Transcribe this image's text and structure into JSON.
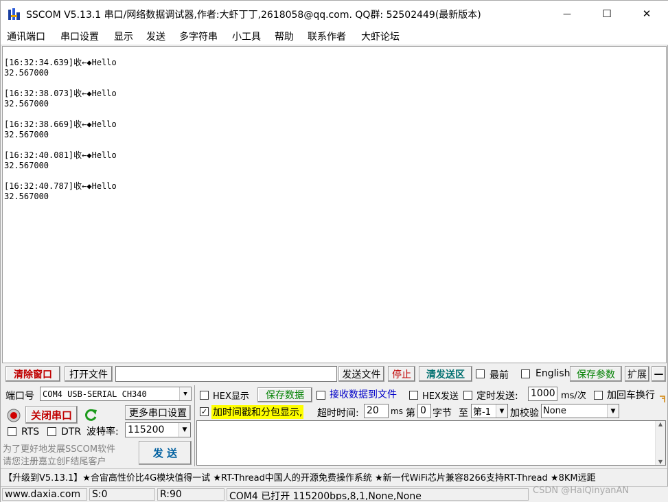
{
  "window": {
    "title": "SSCOM V5.13.1 串口/网络数据调试器,作者:大虾丁丁,2618058@qq.com. QQ群: 52502449(最新版本)",
    "minimize_glyph": "—",
    "maximize_glyph": "☐",
    "close_glyph": "✕",
    "icon": "sscom-app-icon"
  },
  "menu": [
    "通讯端口",
    "串口设置",
    "显示",
    "发送",
    "多字符串",
    "小工具",
    "帮助",
    "联系作者",
    "大虾论坛"
  ],
  "log": [
    {
      "line1": "[16:32:34.639]收←◆Hello",
      "line2": "32.567000"
    },
    {
      "line1": "[16:32:38.073]收←◆Hello",
      "line2": "32.567000"
    },
    {
      "line1": "[16:32:38.669]收←◆Hello",
      "line2": "32.567000"
    },
    {
      "line1": "[16:32:40.081]收←◆Hello",
      "line2": "32.567000"
    },
    {
      "line1": "[16:32:40.787]收←◆Hello",
      "line2": "32.567000"
    }
  ],
  "toolbar": {
    "clear_window": "清除窗口",
    "open_file": "打开文件",
    "file_path": "",
    "send_file": "发送文件",
    "stop": "停止",
    "clear_send_area": "清发送区",
    "topmost": "最前",
    "english": "English",
    "save_params": "保存参数",
    "expand": "扩展",
    "collapse": "—"
  },
  "port": {
    "port_label": "端口号",
    "port_value": "COM4 USB-SERIAL CH340",
    "close_port": "关闭串口",
    "more_settings": "更多串口设置",
    "rts": "RTS",
    "dtr": "DTR",
    "baud_label": "波特率:",
    "baud_value": "115200",
    "promo_line1": "为了更好地发展SSCOM软件",
    "promo_line2": "请您注册嘉立创F结尾客户",
    "send": "发  送"
  },
  "options": {
    "hex_display": "HEX显示",
    "save_data": "保存数据",
    "recv_to_file": "接收数据到文件",
    "hex_send": "HEX发送",
    "timed_send": "定时发送:",
    "interval": "1000",
    "interval_unit": "ms/次",
    "add_crlf": "加回车换行",
    "timestamp": "加时间戳和分包显示,",
    "timeout_label": "超时时间:",
    "timeout_value": "20",
    "timeout_unit": "ms",
    "byte_label_pre": "第",
    "byte_value": "0",
    "byte_label_post": "字节",
    "to_label": "至",
    "to_value": "第-1",
    "checksum_label": "加校验",
    "checksum_value": "None",
    "send_text": ""
  },
  "ticker": "【升级到V5.13.1】★合宙高性价比4G模块值得一试 ★RT-Thread中国人的开源免费操作系统 ★新一代WiFi芯片兼容8266支持RT-Thread ★8KM远距",
  "status": {
    "website": "www.daxia.com",
    "sent": "S:0",
    "received": "R:90",
    "port_status": "COM4 已打开  115200bps,8,1,None,None",
    "watermark": "CSDN @HaiQinyanAN"
  },
  "colors": {
    "red": "#c00000",
    "green": "#008000",
    "blue": "#0000c8",
    "highlight": "#ffff00"
  }
}
